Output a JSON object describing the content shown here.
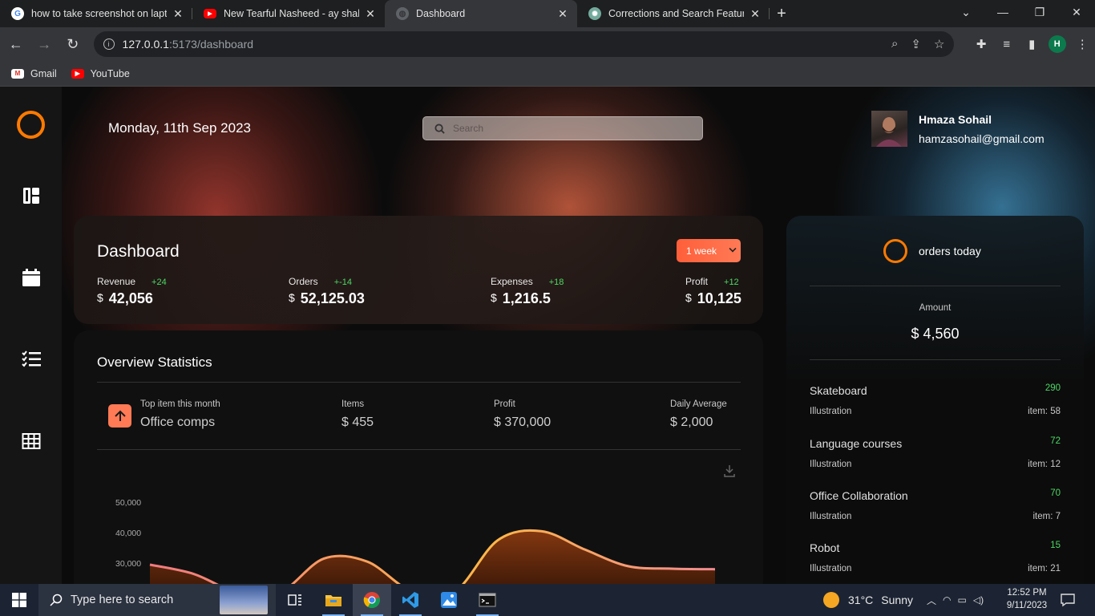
{
  "browser": {
    "tabs": [
      {
        "title": "how to take screenshot on laptop",
        "favicon": "google-icon",
        "active": false
      },
      {
        "title": "New Tearful Nasheed - ay shaheed",
        "favicon": "youtube-icon",
        "active": false
      },
      {
        "title": "Dashboard",
        "favicon": "globe-icon",
        "active": true
      },
      {
        "title": "Corrections and Search Feature",
        "favicon": "chatgpt-icon",
        "active": false
      }
    ],
    "url_host": "127.0.0.1",
    "url_rest": ":5173/dashboard",
    "profile_initial": "H",
    "bookmarks": [
      {
        "label": "Gmail",
        "icon": "gmail-icon"
      },
      {
        "label": "YouTube",
        "icon": "youtube-icon"
      }
    ]
  },
  "header": {
    "date": "Monday, 11th Sep 2023",
    "search_placeholder": "Search",
    "user": {
      "name": "Hmaza Sohail",
      "email": "hamzasohail@gmail.com"
    }
  },
  "dashboard": {
    "title": "Dashboard",
    "period": "1 week",
    "stats": [
      {
        "label": "Revenue",
        "delta": "+24",
        "currency": "$",
        "value": "42,056"
      },
      {
        "label": "Orders",
        "delta": "+-14",
        "currency": "$",
        "value": "52,125.03"
      },
      {
        "label": "Expenses",
        "delta": "+18",
        "currency": "$",
        "value": "1,216.5"
      },
      {
        "label": "Profit",
        "delta": "+12",
        "currency": "$",
        "value": "10,125"
      }
    ]
  },
  "overview": {
    "title": "Overview Statistics",
    "top_item_label": "Top item this month",
    "top_item_value": "Office comps",
    "items_label": "Items",
    "items_value": "$ 455",
    "profit_label": "Profit",
    "profit_value": "$ 370,000",
    "daily_label": "Daily Average",
    "daily_value": "$ 2,000"
  },
  "chart_data": {
    "type": "area",
    "title": "",
    "xlabel": "",
    "ylabel": "",
    "y_ticks": [
      "50,000",
      "40,000",
      "30,000"
    ],
    "ylim": [
      0,
      50000
    ],
    "grid": false,
    "legend": "none",
    "series": [
      {
        "values": [
          30000,
          27000,
          21000,
          21000,
          32000,
          31000,
          21500,
          21000,
          38000,
          41000,
          35000,
          29500,
          28700,
          28500
        ]
      }
    ],
    "stroke_color": "#f08a60",
    "peak_color": "#ffb84a"
  },
  "orders": {
    "title": "orders today",
    "amount_label": "Amount",
    "amount_value": "$ 4,560",
    "items": [
      {
        "name": "Skateboard",
        "count": "290",
        "category": "Illustration",
        "items": "item: 58"
      },
      {
        "name": "Language courses",
        "count": "72",
        "category": "Illustration",
        "items": "item: 12"
      },
      {
        "name": "Office Collaboration",
        "count": "70",
        "category": "Illustration",
        "items": "item: 7"
      },
      {
        "name": "Robot",
        "count": "15",
        "category": "Illustration",
        "items": "item: 21"
      }
    ]
  },
  "taskbar": {
    "search_text": "Type here to search",
    "weather_temp": "31°C",
    "weather_desc": "Sunny",
    "time": "12:52 PM",
    "date": "9/11/2023"
  },
  "colors": {
    "accent": "#ff7a00",
    "button": "#ff6a45",
    "positive": "#4cd964"
  }
}
